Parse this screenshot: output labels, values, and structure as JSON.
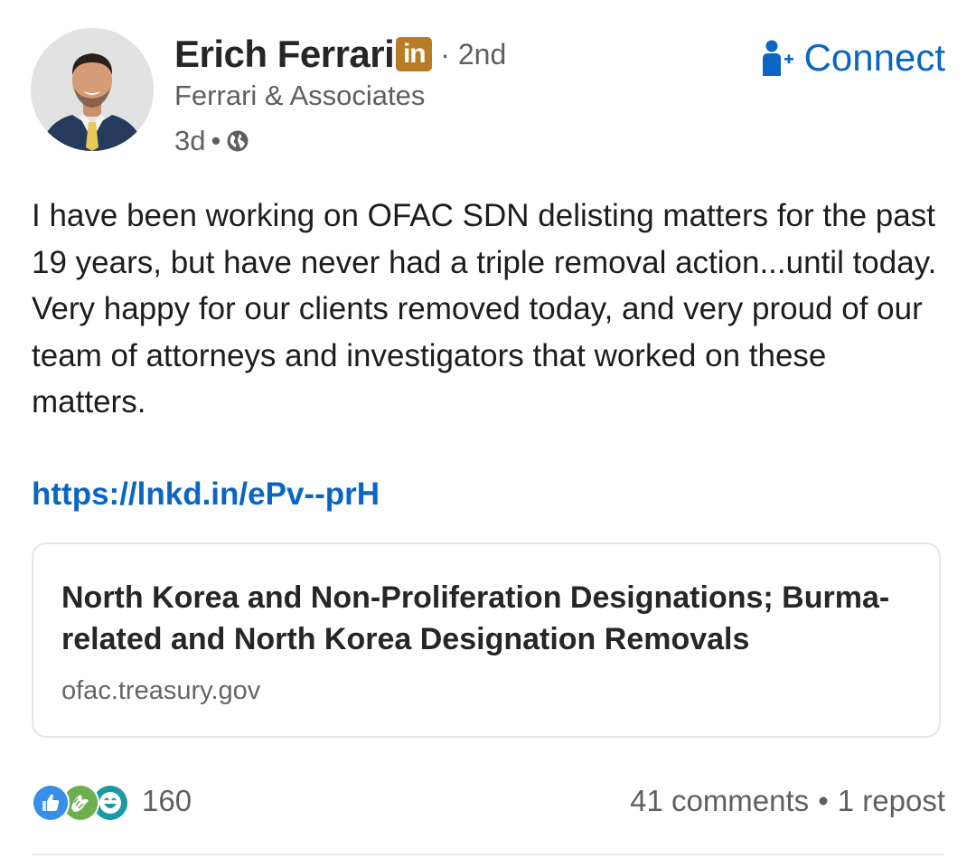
{
  "author": {
    "name": "Erich Ferrari",
    "badge": "in",
    "degree": "· 2nd",
    "company": "Ferrari & Associates",
    "time": "3d",
    "separator": "•",
    "visibility_icon": "globe-icon",
    "avatar_icon": "profile-photo"
  },
  "connect": {
    "label": "Connect",
    "icon": "person-add-icon",
    "color": "#0a66c2"
  },
  "post": {
    "body": "I have been working on OFAC SDN delisting matters for the past 19 years, but  have never had a triple removal action...until today. Very happy for our clients removed today, and very proud of our team of attorneys and investigators that worked on these matters.",
    "link": "https://lnkd.in/ePv--prH"
  },
  "link_card": {
    "title": "North Korea and Non-Proliferation Designations; Burma-related and North Korea Designation Removals",
    "domain": "ofac.treasury.gov"
  },
  "social": {
    "reaction_icons": [
      "like-icon",
      "celebrate-icon",
      "funny-icon"
    ],
    "reaction_count": "160",
    "comments": "41 comments",
    "separator": "•",
    "reposts": "1 repost"
  },
  "colors": {
    "link_blue": "#0a66c2",
    "badge_gold": "#b87c24",
    "secondary_text": "#5f5f5f",
    "body_text": "#1d1d1d"
  }
}
